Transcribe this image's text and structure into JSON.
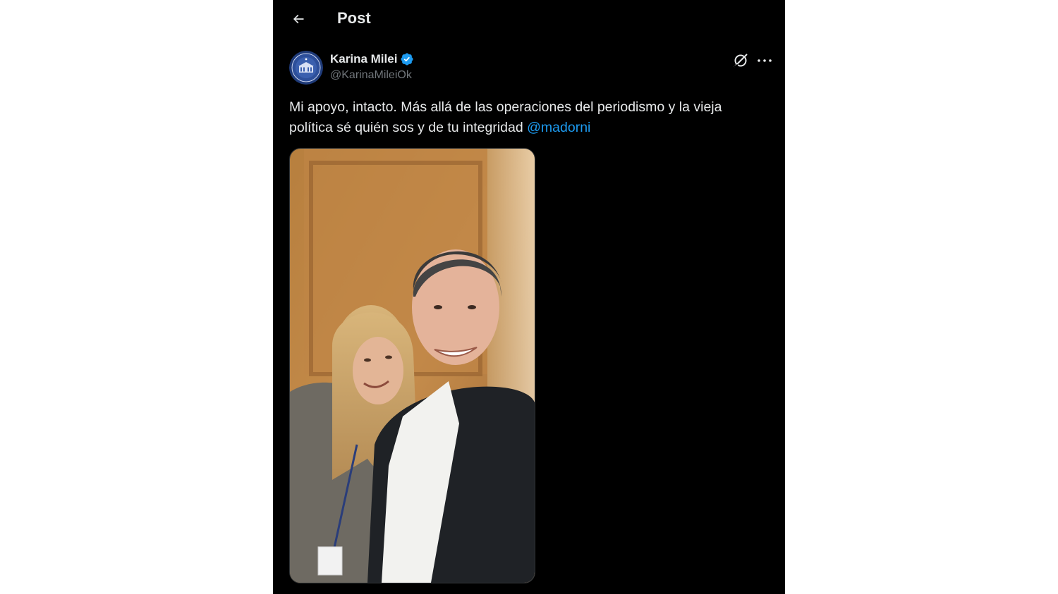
{
  "header": {
    "back_icon": "arrow-left-icon",
    "title": "Post"
  },
  "tweet": {
    "author": {
      "display_name": "Karina Milei",
      "handle": "@KarinaMileiOk",
      "verified_icon": "verified-badge-icon",
      "avatar_icon": "seal-avatar"
    },
    "actions": {
      "grok_icon": "grok-icon",
      "more_icon": "more-options-icon"
    },
    "text_part1": "Mi apoyo, intacto. Más allá de las operaciones del periodismo y la vieja política sé quién sos y de tu integridad ",
    "mention": "@madorni",
    "media": {
      "type": "photo"
    }
  },
  "colors": {
    "background": "#000000",
    "text": "#e7e9ea",
    "secondary_text": "#71767b",
    "link": "#1d9bf0",
    "verified": "#1d9bf0",
    "page_margin": "#ffffff"
  }
}
